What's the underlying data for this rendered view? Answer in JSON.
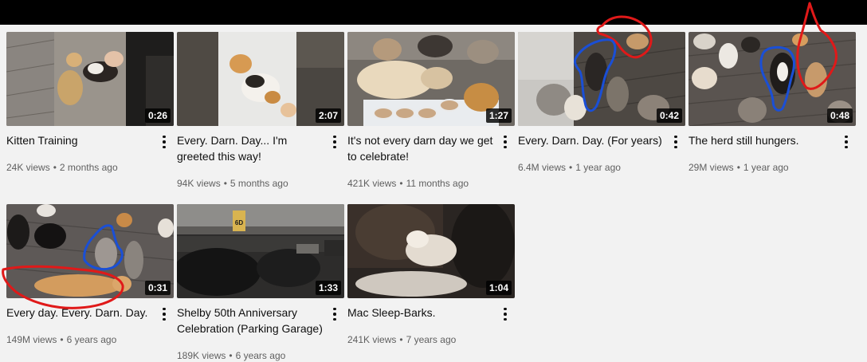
{
  "videos": [
    {
      "title": "Kitten Training",
      "views": "24K views",
      "age": "2 months ago",
      "duration": "0:26"
    },
    {
      "title": "Every. Darn. Day... I'm greeted this way!",
      "views": "94K views",
      "age": "5 months ago",
      "duration": "2:07"
    },
    {
      "title": "It's not every darn day we get to celebrate!",
      "views": "421K views",
      "age": "11 months ago",
      "duration": "1:27"
    },
    {
      "title": "Every. Darn. Day. (For years)",
      "views": "6.4M views",
      "age": "1 year ago",
      "duration": "0:42"
    },
    {
      "title": "The herd still hungers.",
      "views": "29M views",
      "age": "1 year ago",
      "duration": "0:48"
    },
    {
      "title": "Every day. Every. Darn. Day.",
      "views": "149M views",
      "age": "6 years ago",
      "duration": "0:31"
    },
    {
      "title": "Shelby 50th Anniversary Celebration (Parking Garage)",
      "views": "189K views",
      "age": "6 years ago",
      "duration": "1:33"
    },
    {
      "title": "Mac Sleep-Barks.",
      "views": "241K views",
      "age": "7 years ago",
      "duration": "1:04"
    }
  ],
  "separator": "•",
  "signage_text": "6D",
  "colors": {
    "annotation_red": "#e01919",
    "annotation_blue": "#1a4fd6",
    "duration_bg": "#000000",
    "background": "#f2f2f2"
  }
}
